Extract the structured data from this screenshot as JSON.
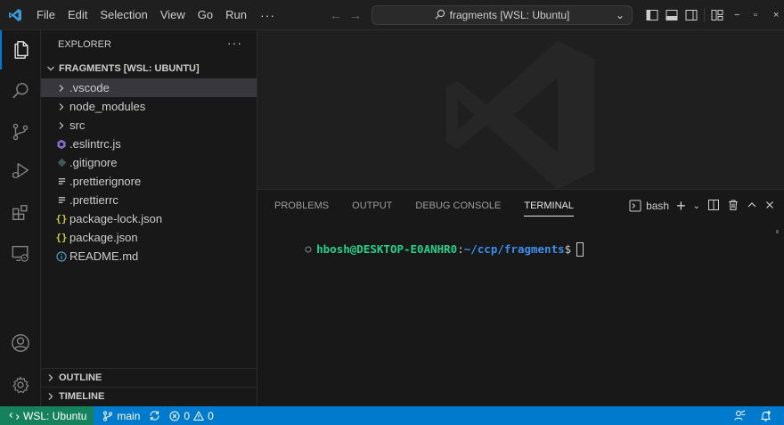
{
  "titlebar": {
    "menu": [
      "File",
      "Edit",
      "Selection",
      "View",
      "Go",
      "Run"
    ],
    "more": "···",
    "command_center": "fragments [WSL: Ubuntu]",
    "accent": "#0078d4"
  },
  "activitybar": {
    "items": [
      "explorer-icon",
      "search-icon",
      "source-control-icon",
      "run-debug-icon",
      "extensions-icon",
      "remote-explorer-icon"
    ],
    "bottom": [
      "account-icon",
      "manage-gear-icon"
    ]
  },
  "sidebar": {
    "header": "EXPLORER",
    "more": "···",
    "folder": "FRAGMENTS [WSL: UBUNTU]",
    "items": [
      {
        "label": ".vscode",
        "type": "folder"
      },
      {
        "label": "node_modules",
        "type": "folder"
      },
      {
        "label": "src",
        "type": "folder"
      },
      {
        "label": ".eslintrc.js",
        "type": "eslint"
      },
      {
        "label": ".gitignore",
        "type": "git"
      },
      {
        "label": ".prettierignore",
        "type": "text"
      },
      {
        "label": ".prettierrc",
        "type": "text"
      },
      {
        "label": "package-lock.json",
        "type": "json"
      },
      {
        "label": "package.json",
        "type": "json"
      },
      {
        "label": "README.md",
        "type": "info"
      }
    ],
    "outline": "OUTLINE",
    "timeline": "TIMELINE"
  },
  "panel": {
    "tabs": [
      "PROBLEMS",
      "OUTPUT",
      "DEBUG CONSOLE",
      "TERMINAL"
    ],
    "active_tab": "TERMINAL",
    "shell": "bash",
    "terminal": {
      "user": "hbosh@DESKTOP-E0ANHR0",
      "colon": ":",
      "path": "~/ccp/fragments",
      "dollar": "$"
    }
  },
  "statusbar": {
    "remote": "WSL: Ubuntu",
    "branch": "main",
    "errors": "0",
    "warnings": "0",
    "colors": {
      "bar": "#007acc",
      "remote": "#16825d"
    }
  }
}
